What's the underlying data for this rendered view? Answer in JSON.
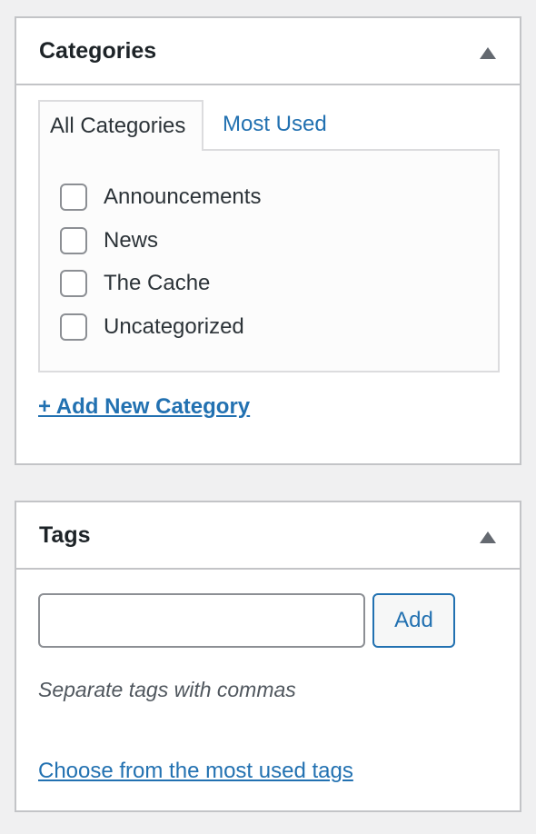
{
  "categories_box": {
    "title": "Categories",
    "toggle_icon": "triangle-up-icon",
    "tabs": [
      {
        "label": "All Categories",
        "active": true
      },
      {
        "label": "Most Used",
        "active": false
      }
    ],
    "items": [
      {
        "label": "Announcements",
        "checked": false
      },
      {
        "label": "News",
        "checked": false
      },
      {
        "label": "The Cache",
        "checked": false
      },
      {
        "label": "Uncategorized",
        "checked": false
      }
    ],
    "add_new_label": "+ Add New Category"
  },
  "tags_box": {
    "title": "Tags",
    "toggle_icon": "triangle-up-icon",
    "input_value": "",
    "input_placeholder": "",
    "add_button_label": "Add",
    "hint": "Separate tags with commas",
    "choose_link": "Choose from the most used tags"
  },
  "colors": {
    "link": "#2271b1",
    "border": "#c3c4c7",
    "background": "#f0f0f1"
  }
}
